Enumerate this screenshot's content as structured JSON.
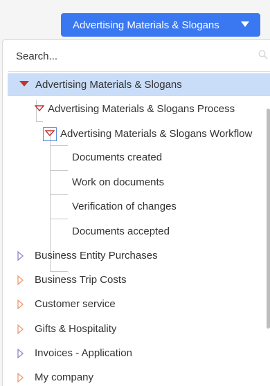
{
  "dropdown": {
    "label": "Advertising Materials & Slogans"
  },
  "search": {
    "placeholder": "Search..."
  },
  "tree": {
    "root": "Advertising Materials & Slogans",
    "process": "Advertising Materials & Slogans Process",
    "workflow": "Advertising Materials & Slogans Workflow",
    "stages": [
      "Documents created",
      "Work on documents",
      "Verification of changes",
      "Documents accepted"
    ],
    "others": [
      "Business Entity Purchases",
      "Business Trip Costs",
      "Customer service",
      "Gifts & Hospitality",
      "Invoices - Application",
      "My company"
    ]
  },
  "colors": {
    "button": "#3a78f2",
    "selected_bg": "#c9dcf8",
    "expanded_triangle": "#c8312f",
    "collapsed_triangle_orange": "#f0a078",
    "collapsed_triangle_purple": "#9a8cd0"
  },
  "icons": {
    "dropdown": "caret-down-icon",
    "search": "search-icon",
    "expanded": "triangle-down-icon",
    "collapsed": "triangle-right-icon"
  }
}
